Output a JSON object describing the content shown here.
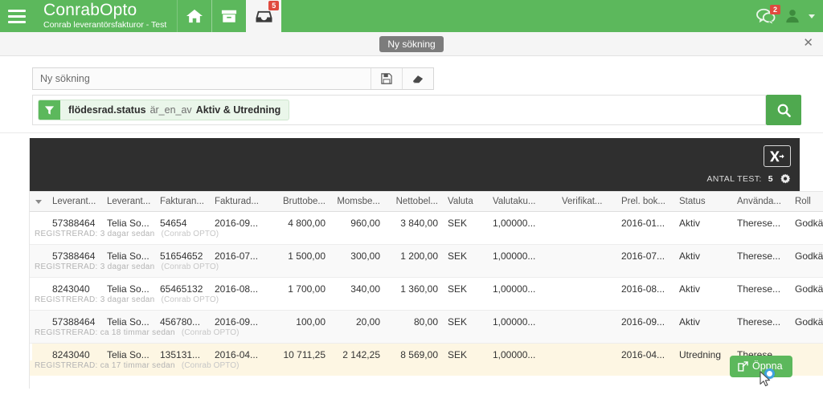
{
  "topbar": {
    "menu_icon": "hamburger-icon",
    "brand_title": "ConrabOpto",
    "brand_subtitle": "Conrab leverantörsfakturor - Test",
    "nav": [
      {
        "icon": "home-icon",
        "label": "Hem",
        "active": false,
        "badge": ""
      },
      {
        "icon": "archive-icon",
        "label": "Arkiv",
        "active": false,
        "badge": ""
      },
      {
        "icon": "inbox-icon",
        "label": "Inkorg",
        "active": true,
        "badge": "5"
      }
    ],
    "chat": {
      "icon": "chat-icon",
      "badge": "2"
    },
    "user": {
      "icon": "user-icon"
    },
    "user_caret": "chevron-down-icon"
  },
  "tabstrip": {
    "tab_label": "Ny sökning",
    "close_label": "✕"
  },
  "search": {
    "name_value": "Ny sökning",
    "name_placeholder": "Ny sökning",
    "save_icon": "save-icon",
    "clear_icon": "eraser-icon",
    "search_icon": "search-icon",
    "filter": {
      "icon": "filter-icon",
      "field": "flödesrad.status",
      "operator": "är_en_av",
      "value": "Aktiv & Utredning"
    }
  },
  "toolbar": {
    "export_icon": "excel-export-icon",
    "count_label": "ANTAL TEST:",
    "count_value": "5",
    "settings_icon": "gear-icon"
  },
  "table": {
    "columns": [
      {
        "label": "Leverant...",
        "align": "left",
        "width": 68
      },
      {
        "label": "Leverant...",
        "align": "left",
        "width": 66
      },
      {
        "label": "Fakturan...",
        "align": "left",
        "width": 68
      },
      {
        "label": "Fakturad...",
        "align": "left",
        "width": 72
      },
      {
        "label": "Bruttobe...",
        "align": "num",
        "width": 78
      },
      {
        "label": "Momsbe...",
        "align": "num",
        "width": 68
      },
      {
        "label": "Nettobel...",
        "align": "num",
        "width": 72
      },
      {
        "label": "Valuta",
        "align": "left",
        "width": 56
      },
      {
        "label": "Valutaku...",
        "align": "left",
        "width": 86
      },
      {
        "label": "Verifikat...",
        "align": "left",
        "width": 74
      },
      {
        "label": "Prel. bok...",
        "align": "left",
        "width": 72
      },
      {
        "label": "Status",
        "align": "left",
        "width": 72
      },
      {
        "label": "Använda...",
        "align": "left",
        "width": 72
      },
      {
        "label": "Roll",
        "align": "left",
        "width": 70
      }
    ],
    "rows": [
      {
        "cells": [
          "57388464",
          "Telia So...",
          "54654",
          "2016-09...",
          "4 800,00",
          "960,00",
          "3 840,00",
          "SEK",
          "1,00000...",
          "",
          "2016-01...",
          "Aktiv",
          "Therese...",
          "Godkän..."
        ],
        "meta_label": "REGISTRERAD: 3 dagar sedan",
        "meta_source": "(Conrab OPTO)",
        "highlight": false,
        "alt": false
      },
      {
        "cells": [
          "57388464",
          "Telia So...",
          "51654652",
          "2016-07...",
          "1 500,00",
          "300,00",
          "1 200,00",
          "SEK",
          "1,00000...",
          "",
          "2016-07...",
          "Aktiv",
          "Therese...",
          "Godkän..."
        ],
        "meta_label": "REGISTRERAD: 3 dagar sedan",
        "meta_source": "(Conrab OPTO)",
        "highlight": false,
        "alt": true
      },
      {
        "cells": [
          "8243040",
          "Telia So...",
          "65465132",
          "2016-08...",
          "1 700,00",
          "340,00",
          "1 360,00",
          "SEK",
          "1,00000...",
          "",
          "2016-08...",
          "Aktiv",
          "Therese...",
          "Godkän..."
        ],
        "meta_label": "REGISTRERAD: 3 dagar sedan",
        "meta_source": "(Conrab OPTO)",
        "highlight": false,
        "alt": false
      },
      {
        "cells": [
          "57388464",
          "Telia So...",
          "456780...",
          "2016-09...",
          "100,00",
          "20,00",
          "80,00",
          "SEK",
          "1,00000...",
          "",
          "2016-09...",
          "Aktiv",
          "Therese...",
          "Godkän..."
        ],
        "meta_label": "REGISTRERAD: ca 18 timmar sedan",
        "meta_source": "(Conrab OPTO)",
        "highlight": false,
        "alt": true
      },
      {
        "cells": [
          "8243040",
          "Telia So...",
          "135131...",
          "2016-04...",
          "10 711,25",
          "2 142,25",
          "8 569,00",
          "SEK",
          "1,00000...",
          "",
          "2016-04...",
          "Utredning",
          "Therese...",
          ""
        ],
        "meta_label": "REGISTRERAD: ca 17 timmar sedan",
        "meta_source": "(Conrab OPTO)",
        "highlight": true,
        "alt": false
      }
    ]
  },
  "open_button": {
    "label": "Öppna",
    "icon": "external-link-icon"
  },
  "colors": {
    "brand_green": "#5cb85c",
    "dark_toolbar": "#2f2f2f",
    "badge_red": "#e04a3f",
    "highlight_row": "#fdf6e3",
    "spinner_blue": "#3fa2e0"
  }
}
